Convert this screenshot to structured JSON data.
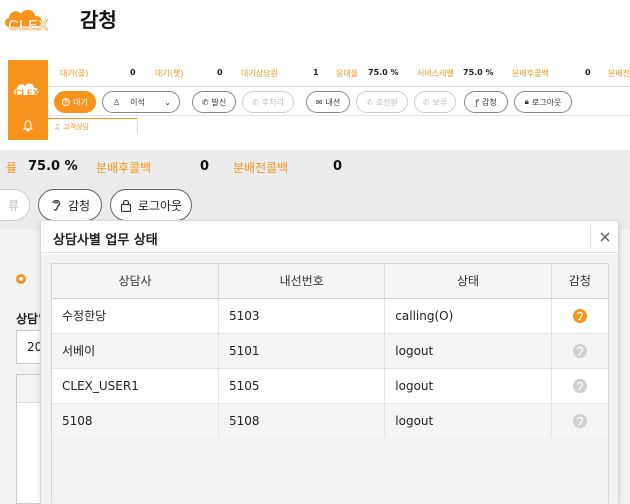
{
  "header": {
    "logo_text": "CLEX",
    "title": "감청"
  },
  "thumb": {
    "stats": [
      {
        "label": "대기(콜)",
        "value": "0"
      },
      {
        "label": "대기(챗)",
        "value": "0"
      },
      {
        "label": "대기상담원",
        "value": "1"
      },
      {
        "label": "응대율",
        "value": "75.0 %"
      },
      {
        "label": "서비스레벨",
        "value": "75.0 %"
      },
      {
        "label": "분배후콜백",
        "value": "0"
      },
      {
        "label": "분배전",
        "value": ""
      }
    ],
    "status_button": "대기",
    "status_select": "이석",
    "buttons": {
      "dial": "발신",
      "after": "후처리",
      "ext": "내선",
      "consult": "호전환",
      "hold": "보류",
      "monitor": "감청",
      "logout": "로그아웃"
    },
    "tab_label": "고객상담"
  },
  "zoom": {
    "stats": [
      {
        "label": "률",
        "value": "75.0 %"
      },
      {
        "label": "분배후콜백",
        "value": "0"
      },
      {
        "label": "분배전콜백",
        "value": "0"
      }
    ],
    "partial_button": "류",
    "monitor_button": "감청",
    "logout_button": "로그아웃",
    "underlay_label": "상담'",
    "underlay_value": "20"
  },
  "modal": {
    "title": "상담사별 업무 상태",
    "columns": [
      "상담사",
      "내선번호",
      "상태",
      "감청"
    ],
    "rows": [
      {
        "agent": "수정한당",
        "ext": "5103",
        "status": "calling(O)",
        "active": true
      },
      {
        "agent": "서베이",
        "ext": "5101",
        "status": "logout",
        "active": false
      },
      {
        "agent": "CLEX_USER1",
        "ext": "5105",
        "status": "logout",
        "active": false
      },
      {
        "agent": "5108",
        "ext": "5108",
        "status": "logout",
        "active": false
      }
    ]
  },
  "colors": {
    "brand": "#f7941d",
    "inactive_icon": "#d0d0d0"
  }
}
